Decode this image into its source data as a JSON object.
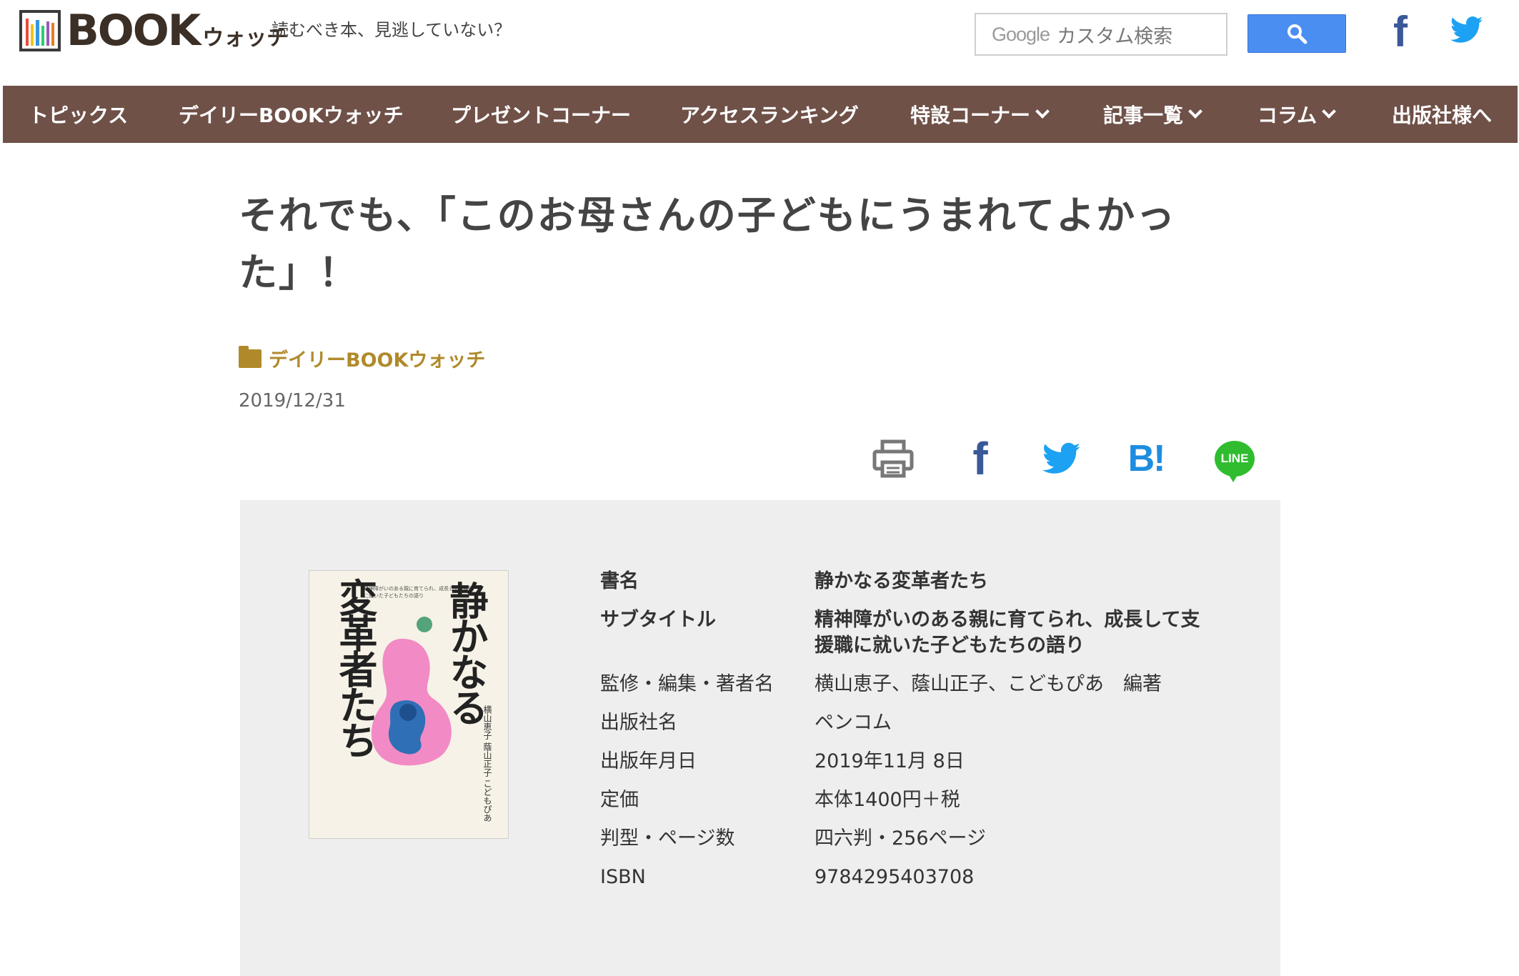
{
  "site": {
    "logo_text": "BOOK",
    "logo_kana": "ウォッチ",
    "tagline": "読むべき本、見逃していない？"
  },
  "search": {
    "google_label": "Google",
    "placeholder": "カスタム検索"
  },
  "nav": {
    "items": [
      {
        "label": "トピックス"
      },
      {
        "label": "デイリーBOOKウォッチ"
      },
      {
        "label": "プレゼントコーナー"
      },
      {
        "label": "アクセスランキング"
      },
      {
        "label": "特設コーナー"
      },
      {
        "label": "記事一覧"
      },
      {
        "label": "コラム"
      },
      {
        "label": "出版社様へ"
      }
    ]
  },
  "article": {
    "title_line1": "それでも、「このお母さんの子どもにうまれてよかっ",
    "title_line2": "た」！",
    "category": "デイリーBOOKウォッチ",
    "date": "2019/12/31"
  },
  "share": {
    "hatena": "B!",
    "line": "LINE"
  },
  "book": {
    "cover_title_right": "静かなる",
    "cover_title_left": "変革者たち",
    "cover_authors": "横山恵子 蔭山正子 こどもぴあ",
    "cover_subtitle": "精神障がいのある親に育てられ、成長して支援職に就いた子どもたちの語り",
    "rows": [
      {
        "key": "書名",
        "value": "静かなる変革者たち"
      },
      {
        "key": "サブタイトル",
        "value": "精神障がいのある親に育てられ、成長して支援職に就いた子どもたちの語り"
      },
      {
        "key": "監修・編集・著者名",
        "value": "横山恵子、蔭山正子、こどもぴあ　編著"
      },
      {
        "key": "出版社名",
        "value": "ペンコム"
      },
      {
        "key": "出版年月日",
        "value": "2019年11月 8日"
      },
      {
        "key": "定価",
        "value": "本体1400円＋税"
      },
      {
        "key": "判型・ページ数",
        "value": "四六判・256ページ"
      },
      {
        "key": "ISBN",
        "value": "9784295403708"
      }
    ]
  },
  "colors": {
    "nav_bg": "#6f5148",
    "accent_gold": "#b08a2a",
    "search_btn": "#4b8ef1",
    "facebook": "#3b5998",
    "twitter": "#1da1f2",
    "line": "#2fbd2f"
  }
}
